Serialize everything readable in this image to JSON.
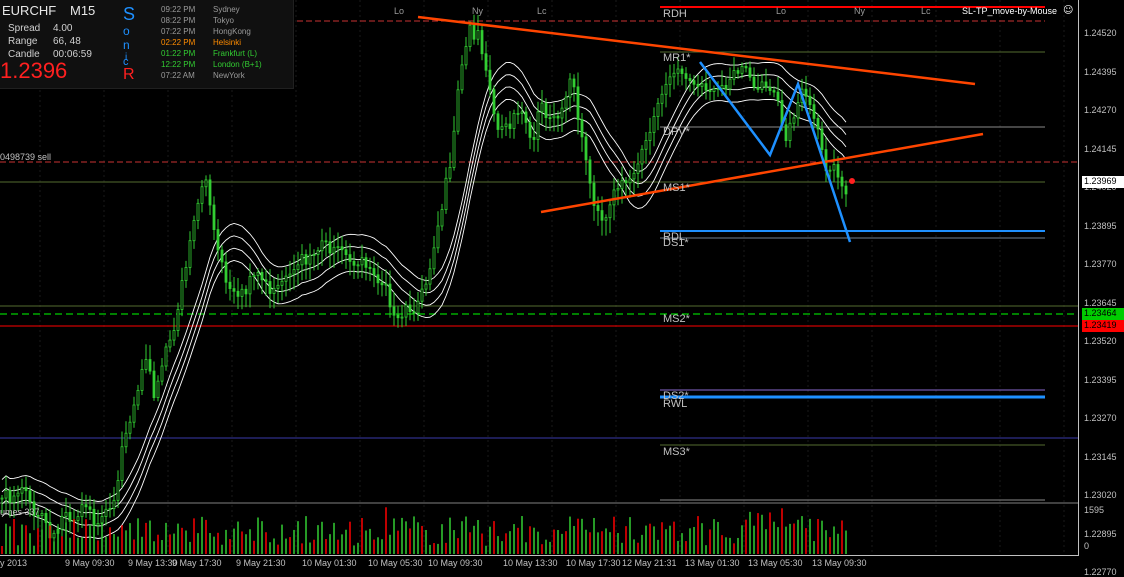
{
  "info": {
    "symbol": "EURCHF",
    "timeframe": "M15",
    "spread_label": "Spread",
    "spread_value": "4.00",
    "range_label": "Range",
    "range_value": "66, 48",
    "candle_label": "Candle",
    "candle_value": "00:06:59",
    "price": "1.2396",
    "sonic_letters": [
      "S",
      "o",
      "n",
      "i",
      "c",
      "R"
    ]
  },
  "sessions": [
    {
      "time": "09:22 PM",
      "city": "Sydney",
      "color": "#9a9a9a"
    },
    {
      "time": "08:22 PM",
      "city": "Tokyo",
      "color": "#9a9a9a"
    },
    {
      "time": "07:22 PM",
      "city": "HongKong",
      "color": "#9a9a9a"
    },
    {
      "time": "02:22 PM",
      "city": "Helsinki",
      "color": "#ff8c00"
    },
    {
      "time": "01:22 PM",
      "city": "Frankfurt  (L)",
      "color": "#32cd32"
    },
    {
      "time": "12:22 PM",
      "city": "London  (B+1)",
      "color": "#32cd32"
    },
    {
      "time": "07:22 AM",
      "city": "NewYork",
      "color": "#9a9a9a"
    }
  ],
  "ea_label": "SL-TP_move-by-Mouse",
  "order_label": "0498739 sell",
  "volumes_label": "umes 337",
  "session_markers": [
    "Lo",
    "Ny",
    "Lc",
    "Lo",
    "Ny",
    "Lc"
  ],
  "levels": [
    "RDH",
    "MR1*",
    "DPV*",
    "MS1*",
    "RDL",
    "DS1*",
    "MS2*",
    "DS2*",
    "RWL",
    "MS3*"
  ],
  "price_axis": [
    "1.24520",
    "1.24395",
    "1.24270",
    "1.24145",
    "1.24020",
    "1.23895",
    "1.23770",
    "1.23645",
    "1.23520",
    "1.23395",
    "1.23270",
    "1.23145",
    "1.23020",
    "1.22895",
    "1.22770"
  ],
  "price_tags": {
    "current": "1.23969",
    "green": "1.23464",
    "red": "1.23419"
  },
  "volume_axis": [
    "1595",
    "0"
  ],
  "time_axis": [
    "y 2013",
    "9 May 09:30",
    "9 May 13:30",
    "9 May 17:30",
    "9 May 21:30",
    "10 May 01:30",
    "10 May 05:30",
    "10 May 09:30",
    "10 May 13:30",
    "10 May 17:30",
    "12 May 21:31",
    "13 May 01:30",
    "13 May 05:30",
    "13 May 09:30"
  ],
  "colors": {
    "candle": "#32cd32",
    "ma": "#ffffff",
    "trend": "#ff4500",
    "pattern": "#1e90ff",
    "red": "#ff0000",
    "green": "#00ff00"
  },
  "chart_data": {
    "type": "candlestick",
    "ylim": [
      1.2272,
      1.246
    ],
    "close_points": [
      1.2301,
      1.2299,
      1.2303,
      1.2298,
      1.2296,
      1.2289,
      1.2294,
      1.2291,
      1.2297,
      1.2294,
      1.2298,
      1.2303,
      1.2317,
      1.233,
      1.2344,
      1.2335,
      1.2349,
      1.2359,
      1.2373,
      1.2393,
      1.2405,
      1.2387,
      1.2373,
      1.237,
      1.2367,
      1.2375,
      1.2369,
      1.2372,
      1.2375,
      1.238,
      1.2376,
      1.2381,
      1.2383,
      1.2386,
      1.2381,
      1.2377,
      1.2375,
      1.2368,
      1.2367,
      1.2361,
      1.2365,
      1.2363,
      1.2372,
      1.2388,
      1.241,
      1.244,
      1.2455,
      1.2448,
      1.243,
      1.2418,
      1.2424,
      1.243,
      1.2418,
      1.2427,
      1.2421,
      1.2425,
      1.244,
      1.242,
      1.24,
      1.2388,
      1.2398,
      1.2401,
      1.2408,
      1.2415,
      1.2426,
      1.2431,
      1.2437,
      1.2439,
      1.2436,
      1.2437,
      1.2434,
      1.2431,
      1.2437,
      1.2442,
      1.2436,
      1.2438,
      1.2432,
      1.2415,
      1.2425,
      1.2435,
      1.2425,
      1.241,
      1.2405,
      1.2399
    ]
  }
}
